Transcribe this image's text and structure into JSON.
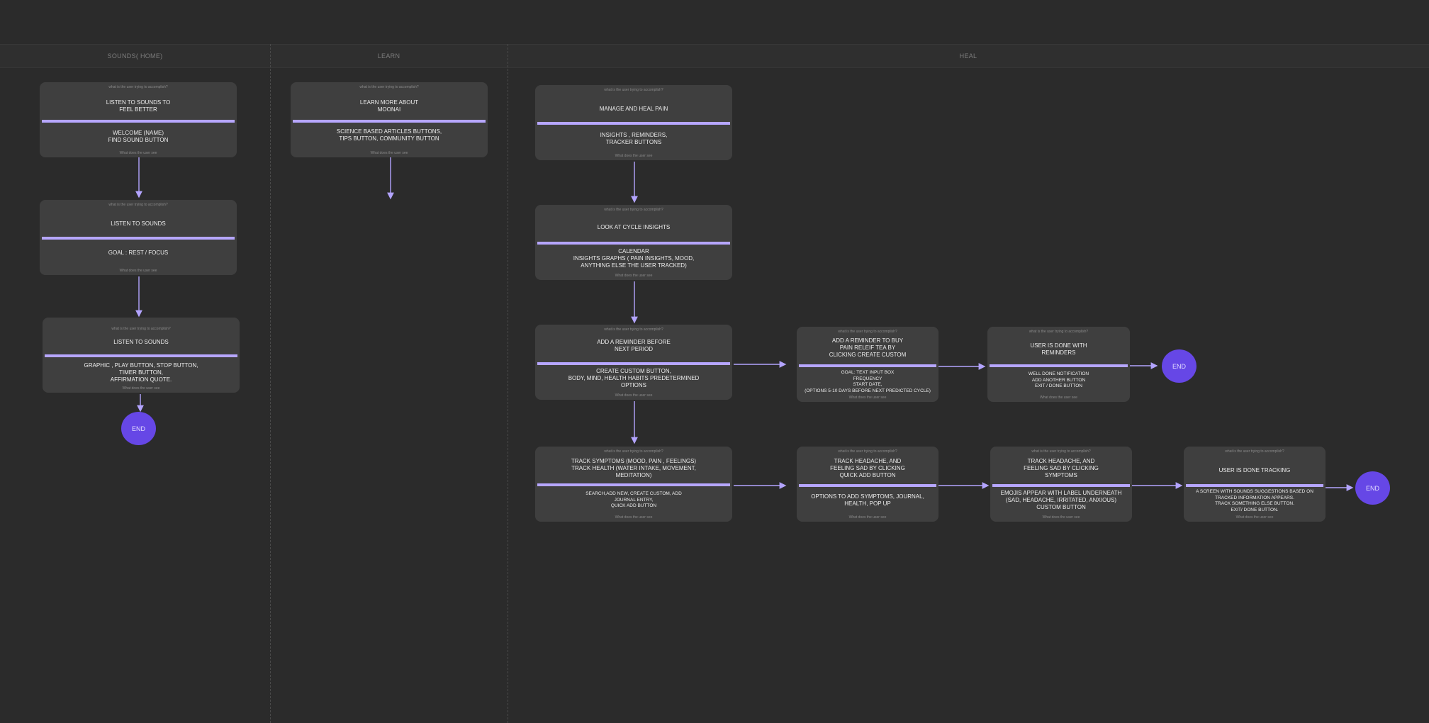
{
  "lanes": [
    "SOUNDS( HOME)",
    "LEARN",
    "HEAL"
  ],
  "card_question": "what is the user trying to accomplish?",
  "card_footer": "What does the user see",
  "end_label": "END",
  "colors": {
    "background": "#2b2b2b",
    "card": "#3f3f3f",
    "separator": "#b6a6ff",
    "end_node": "#6647e6",
    "arrow": "#b3a4ff"
  },
  "cards": [
    {
      "id": "s1",
      "goal": "LISTEN TO SOUNDS TO\nFEEL BETTER",
      "sees": "WELCOME (NAME)\nFIND SOUND BUTTON"
    },
    {
      "id": "s2",
      "goal": "LISTEN TO SOUNDS",
      "sees": "GOAL  : REST / FOCUS"
    },
    {
      "id": "s3",
      "goal": "LISTEN TO SOUNDS",
      "sees": "GRAPHIC , PLAY BUTTON, STOP BUTTON,\nTIMER BUTTON,\nAFFIRMATION QUOTE."
    },
    {
      "id": "l1",
      "goal": "LEARN MORE ABOUT\nMOONAI",
      "sees": "SCIENCE BASED ARTICLES BUTTONS,\nTIPS BUTTON, COMMUNITY BUTTON"
    },
    {
      "id": "h1",
      "goal": "MANAGE AND HEAL PAIN",
      "sees": "INSIGHTS , REMINDERS,\nTRACKER BUTTONS"
    },
    {
      "id": "h2",
      "goal": "LOOK AT CYCLE INSIGHTS",
      "sees": "CALENDAR\nINSIGHTS GRAPHS ( PAIN INSIGHTS, MOOD,\nANYTHING ELSE THE USER TRACKED)"
    },
    {
      "id": "h3",
      "goal": "ADD A REMINDER BEFORE\nNEXT PERIOD",
      "sees": "CREATE CUSTOM BUTTON,\nBODY, MIND, HEALTH HABITS PREDETERMINED\nOPTIONS"
    },
    {
      "id": "h4",
      "goal": "ADD A REMINDER TO BUY\nPAIN RELEIF TEA BY\nCLICKING CREATE CUSTOM",
      "sees": "GOAL: TEXT INPUT BOX\nFREQUENCY\nSTART DATE,\n(OPTIONS 5-10 DAYS BEFORE NEXT PREDICTED CYCLE)"
    },
    {
      "id": "h5",
      "goal": "USER IS DONE WITH\nREMINDERS",
      "sees": "WELL DONE NOTIFICATION\nADD ANOTHER BUTTON\nEXIT / DONE BUTTON"
    },
    {
      "id": "h6",
      "goal": "TRACK SYMPTOMS (MOOD, PAIN , FEELINGS)\nTRACK HEALTH (WATER INTAKE, MOVEMENT,\nMEDITATION)",
      "sees": "SEARCH,ADD NEW, CREATE CUSTOM, ADD\nJOURNAL ENTRY,\nQUICK ADD BUTTON"
    },
    {
      "id": "h7",
      "goal": "TRACK HEADACHE, AND\nFEELING SAD BY CLICKING\nQUICK ADD BUTTON",
      "sees": "OPTIONS TO ADD SYMPTOMS, JOURNAL,\nHEALTH, POP UP"
    },
    {
      "id": "h8",
      "goal": "TRACK HEADACHE, AND\nFEELING SAD BY CLICKING\nSYMPTOMS",
      "sees": "EMOJIS APPEAR WITH LABEL UNDERNEATH\n(SAD, HEADACHE, IRRITATED, ANXIOUS)\nCUSTOM BUTTON"
    },
    {
      "id": "h9",
      "goal": "USER IS DONE TRACKING",
      "sees": "A SCREEN WITH SOUNDS SUGGESTIONS BASED ON\nTRACKED INFORMATION APPEARS.\nTRACK SOMETHING ELSE BUTTON.\nEXIT/ DONE BUTTON."
    }
  ]
}
